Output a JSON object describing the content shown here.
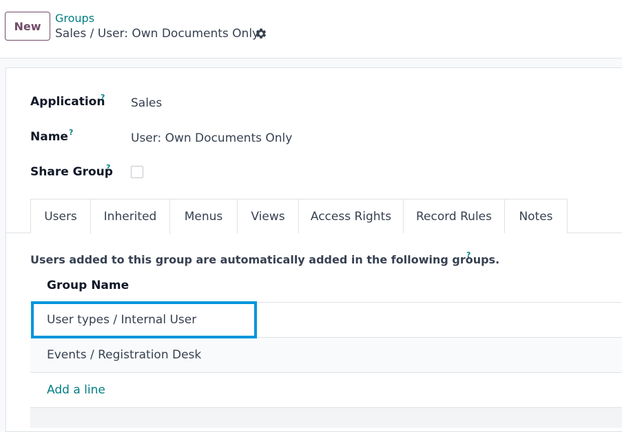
{
  "control_panel": {
    "new_button": "New",
    "breadcrumb_parent": "Groups",
    "breadcrumb_current": "Sales / User: Own Documents Only"
  },
  "form": {
    "application_label": "Application",
    "application_value": "Sales",
    "name_label": "Name",
    "name_value": "User: Own Documents Only",
    "share_group_label": "Share Group",
    "share_group_checked": false,
    "help_marker": "?"
  },
  "tabs": [
    {
      "label": "Users"
    },
    {
      "label": "Inherited",
      "active": true
    },
    {
      "label": "Menus"
    },
    {
      "label": "Views"
    },
    {
      "label": "Access Rights"
    },
    {
      "label": "Record Rules"
    },
    {
      "label": "Notes"
    }
  ],
  "inherited": {
    "description": "Users added to this group are automatically added in the following groups.",
    "column_header": "Group Name",
    "rows": [
      {
        "group_name": "User types / Internal User"
      },
      {
        "group_name": "Events / Registration Desk"
      }
    ],
    "add_line": "Add a line"
  },
  "colors": {
    "brand": "#714b67",
    "link": "#017e84",
    "highlight": "#0095db"
  }
}
